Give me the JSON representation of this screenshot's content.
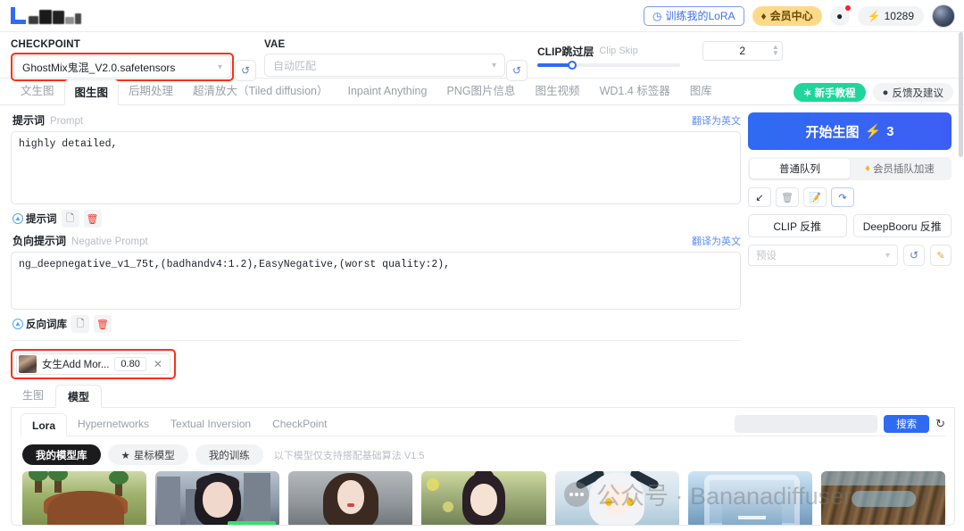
{
  "topbar": {
    "logo_alt": "liblib-logo",
    "train_lora": "训练我的LoRA",
    "vip_center": "会员中心",
    "coins": "10289",
    "coin_icon": "lightning-icon",
    "message_icon": "message-icon"
  },
  "model_row": {
    "checkpoint_label": "CHECKPOINT",
    "checkpoint_value": "GhostMix鬼混_V2.0.safetensors",
    "vae_label": "VAE",
    "vae_placeholder": "自动匹配",
    "clip_skip_cn": "CLIP跳过层",
    "clip_skip_en": "Clip Skip",
    "clip_skip_value": "2",
    "refresh_icon": "refresh-icon",
    "highlight_color": "#ff2d1a"
  },
  "main_tabs": [
    {
      "label": "文生图",
      "active": false
    },
    {
      "label": "图生图",
      "active": true
    },
    {
      "label": "后期处理",
      "active": false
    },
    {
      "label": "超清放大（Tiled diffusion）",
      "active": false
    },
    {
      "label": "Inpaint Anything",
      "active": false
    },
    {
      "label": "PNG图片信息",
      "active": false
    },
    {
      "label": "图生视频",
      "active": false
    },
    {
      "label": "WD1.4 标签器",
      "active": false
    },
    {
      "label": "图库",
      "active": false
    }
  ],
  "main_tabs_right": {
    "tutorial": "新手教程",
    "tutorial_icon": "sparkle-icon",
    "feedback": "反馈及建议",
    "feedback_icon": "chat-icon"
  },
  "prompt": {
    "label_cn": "提示词",
    "label_en": "Prompt",
    "translate_link": "翻译为英文",
    "value": "highly detailed,",
    "tool_label": "提示词",
    "copy_icon": "copy-icon",
    "delete_icon": "trash-icon"
  },
  "negative_prompt": {
    "label_cn": "负向提示词",
    "label_en": "Negative Prompt",
    "translate_link": "翻译为英文",
    "value": "ng_deepnegative_v1_75t,(badhandv4:1.2),EasyNegative,(worst quality:2),",
    "tool_label": "反向词库",
    "copy_icon": "copy-icon",
    "delete_icon": "trash-icon"
  },
  "lora_tag": {
    "name": "女生Add Mor...",
    "weight": "0.80",
    "close_icon": "close-icon",
    "highlight_color": "#ff2d1a"
  },
  "right_panel": {
    "generate_label": "开始生图",
    "generate_icon": "lightning-icon",
    "generate_count": "3",
    "queue_normal": "普通队列",
    "queue_vip": "会员插队加速",
    "queue_vip_icon": "diamond-icon",
    "mini_buttons": [
      {
        "icon": "arrow-down-left-icon",
        "name": "restore-params"
      },
      {
        "icon": "trash-icon",
        "name": "clear-params"
      },
      {
        "icon": "notepad-icon",
        "name": "styles-icon"
      },
      {
        "icon": "recycle-icon",
        "name": "apply-style"
      }
    ],
    "clip_interrogate": "CLIP 反推",
    "deepbooru_interrogate": "DeepBooru 反推",
    "preset_placeholder": "预设",
    "preset_refresh_icon": "refresh-icon",
    "preset_edit_icon": "edit-icon"
  },
  "bottom": {
    "sub_tabs": [
      {
        "label": "生图",
        "active": false
      },
      {
        "label": "模型",
        "active": true
      }
    ],
    "lib_tabs": [
      {
        "label": "Lora",
        "active": true
      },
      {
        "label": "Hypernetworks",
        "active": false
      },
      {
        "label": "Textual Inversion",
        "active": false
      },
      {
        "label": "CheckPoint",
        "active": false
      }
    ],
    "search_value": "",
    "search_button": "搜索",
    "refresh_icon": "refresh-icon",
    "pills": [
      {
        "label": "我的模型库",
        "active": true,
        "icon": ""
      },
      {
        "label": "星标模型",
        "active": false,
        "icon": "star-icon"
      },
      {
        "label": "我的训练",
        "active": false,
        "icon": ""
      }
    ],
    "pill_note": "以下模型仅支持搭配基础算法 V1.5",
    "thumbnails": [
      {
        "name": "thumb-cartoon-hat",
        "style": "t1"
      },
      {
        "name": "thumb-city-girl",
        "style": "t2"
      },
      {
        "name": "thumb-portrait-gray",
        "style": "t3"
      },
      {
        "name": "thumb-flower-girl",
        "style": "t4"
      },
      {
        "name": "thumb-anime-white-hair",
        "style": "t5"
      },
      {
        "name": "thumb-blue-corridor",
        "style": "t6"
      },
      {
        "name": "thumb-glasses-hair",
        "style": "t7"
      }
    ]
  },
  "watermark": {
    "text": "公众号 · Bananadiffuser",
    "icon": "chat-bubble-icon"
  }
}
